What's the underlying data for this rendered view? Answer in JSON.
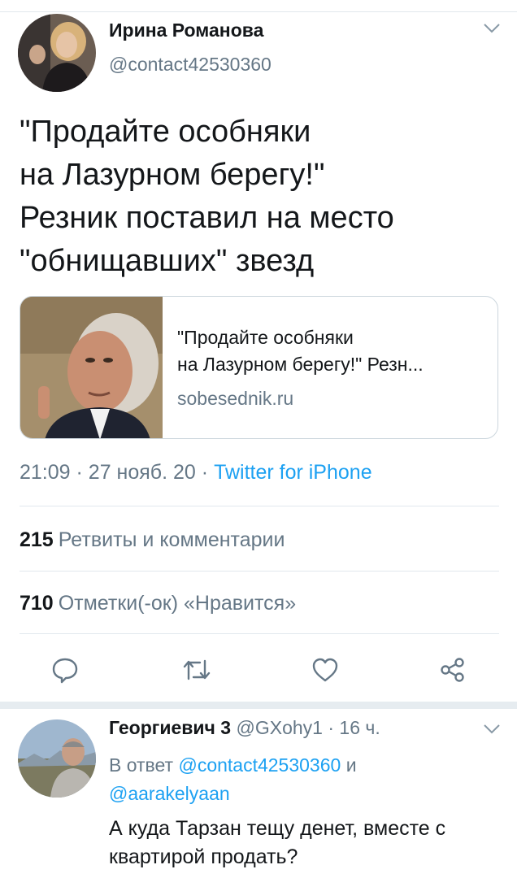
{
  "tweet": {
    "author_name": "Ирина Романова",
    "author_handle": "@contact42530360",
    "text": "\"Продайте особняки\nна Лазурном берегу!\"\nРезник поставил на место\n\"обнищавших\" звезд",
    "card": {
      "title_line1": "\"Продайте особняки",
      "title_line2": "на Лазурном берегу!\" Резн...",
      "domain": "sobesednik.ru"
    },
    "time": "21:09",
    "date": "27 нояб. 20",
    "separator": "·",
    "source": "Twitter for iPhone",
    "retweets_count": "215",
    "retweets_label": "Ретвиты и комментарии",
    "likes_count": "710",
    "likes_label": "Отметки(-ок) «Нравится»"
  },
  "actions": {
    "icons": [
      "reply-icon",
      "retweet-icon",
      "like-icon",
      "share-icon"
    ],
    "color": "#657786"
  },
  "reply": {
    "author_name": "Георгиевич 3",
    "author_handle": "@GXohy1",
    "separator": "·",
    "time": "16 ч.",
    "replying_prefix": "В ответ",
    "mention1": "@contact42530360",
    "conjunction": "и",
    "mention2": "@aarakelyaan",
    "text": "А куда Тарзан тещу денет, вместе с квартирой продать?"
  },
  "colors": {
    "link": "#1da1f2",
    "secondary": "#657786",
    "text": "#14171a",
    "divider": "#e1e8ed"
  }
}
